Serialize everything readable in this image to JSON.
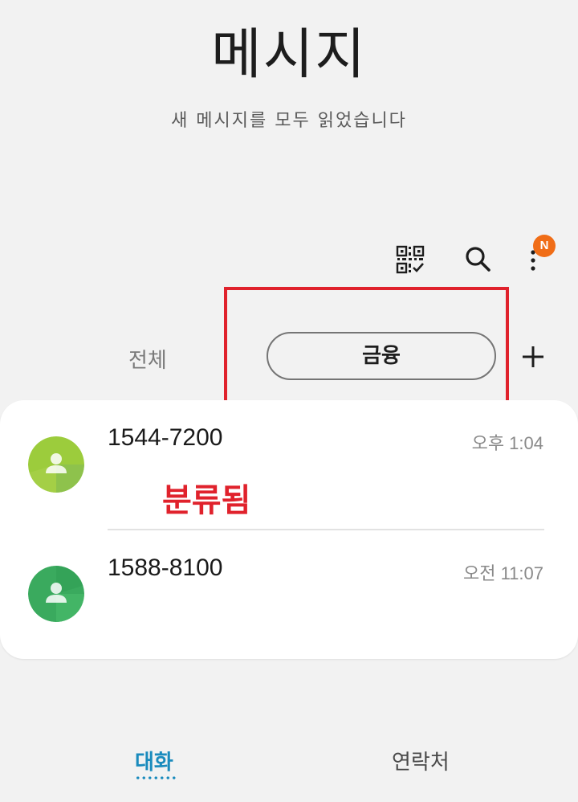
{
  "header": {
    "title": "메시지",
    "subtitle": "새 메시지를 모두 읽었습니다"
  },
  "toolbar": {
    "qr_icon": "qr-code-icon",
    "search_icon": "search-icon",
    "more_icon": "more-vertical-icon",
    "notification_badge": "N",
    "badge_color": "#f06d17"
  },
  "tabs": [
    {
      "label": "전체",
      "selected": false
    },
    {
      "label": "금융",
      "selected": true
    }
  ],
  "add_tab_icon": "plus-icon",
  "annotation": {
    "label": "분류됨",
    "color": "#e0222c"
  },
  "conversations": [
    {
      "sender": "1544-7200",
      "time": "오후 1:04",
      "avatar_color": "#9ccc3c"
    },
    {
      "sender": "1588-8100",
      "time": "오전 11:07",
      "avatar_color": "#3aaa5e"
    }
  ],
  "bottom_nav": [
    {
      "label": "대화",
      "active": true
    },
    {
      "label": "연락처",
      "active": false
    }
  ],
  "colors": {
    "accent": "#1a8bbd",
    "background": "#f2f2f2"
  }
}
